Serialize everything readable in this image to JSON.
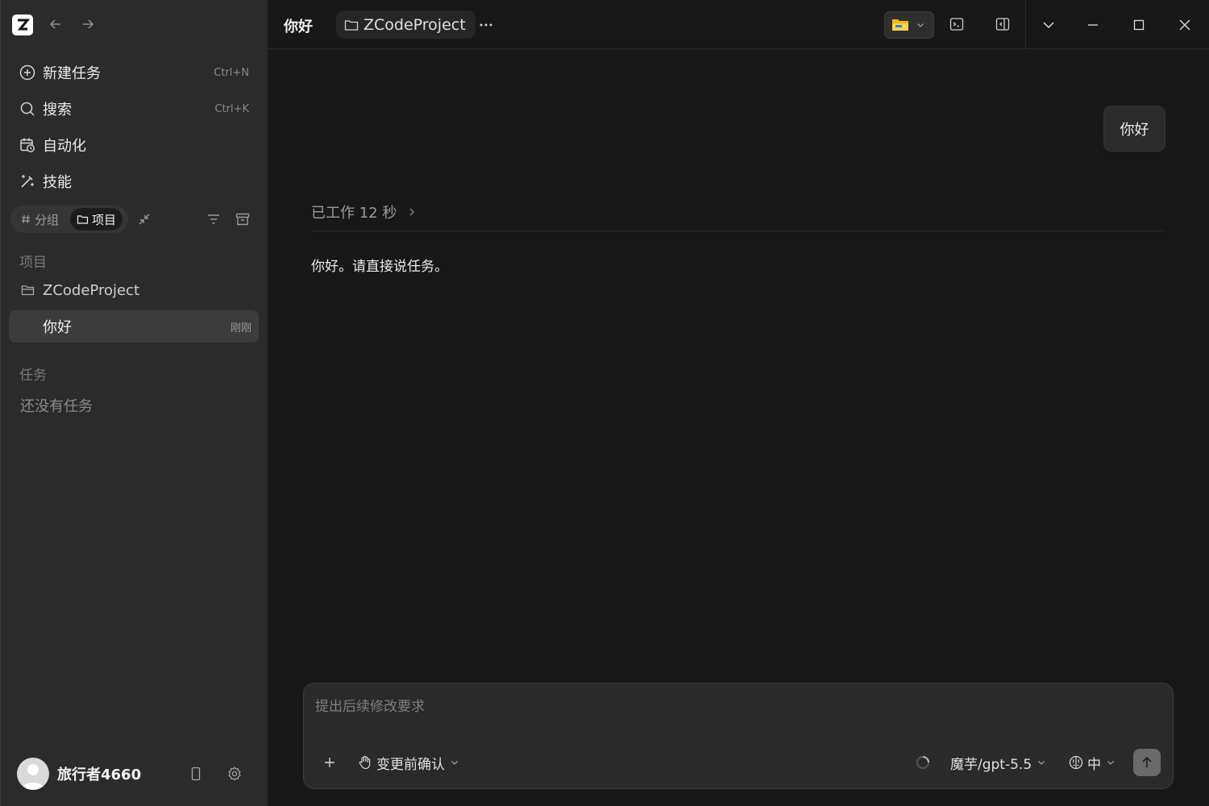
{
  "sidebar": {
    "menu": [
      {
        "label": "新建任务",
        "shortcut": "Ctrl+N"
      },
      {
        "label": "搜索",
        "shortcut": "Ctrl+K"
      },
      {
        "label": "自动化",
        "shortcut": ""
      },
      {
        "label": "技能",
        "shortcut": ""
      }
    ],
    "filter": {
      "group_label": "分组",
      "project_label": "项目"
    },
    "projects_section_label": "项目",
    "project": {
      "name": "ZCodeProject"
    },
    "active_task": {
      "label": "你好",
      "time": "刚刚"
    },
    "tasks_section_label": "任务",
    "empty_tasks": "还没有任务",
    "user": {
      "name": "旅行者4660"
    }
  },
  "header": {
    "title": "你好",
    "project_chip": "ZCodeProject"
  },
  "conversation": {
    "user_message": "你好",
    "work_status": "已工作 12 秒",
    "assistant_reply": "你好。请直接说任务。"
  },
  "composer": {
    "placeholder": "提出后续修改要求",
    "approval_mode": "变更前确认",
    "model": "魔芋/gpt-5.5",
    "effort": "中"
  },
  "colors": {
    "sidebar_bg": "#2b2b2b",
    "main_bg": "#181818",
    "selected_row": "#3c3c3c",
    "send_button": "#6a6a6a"
  }
}
